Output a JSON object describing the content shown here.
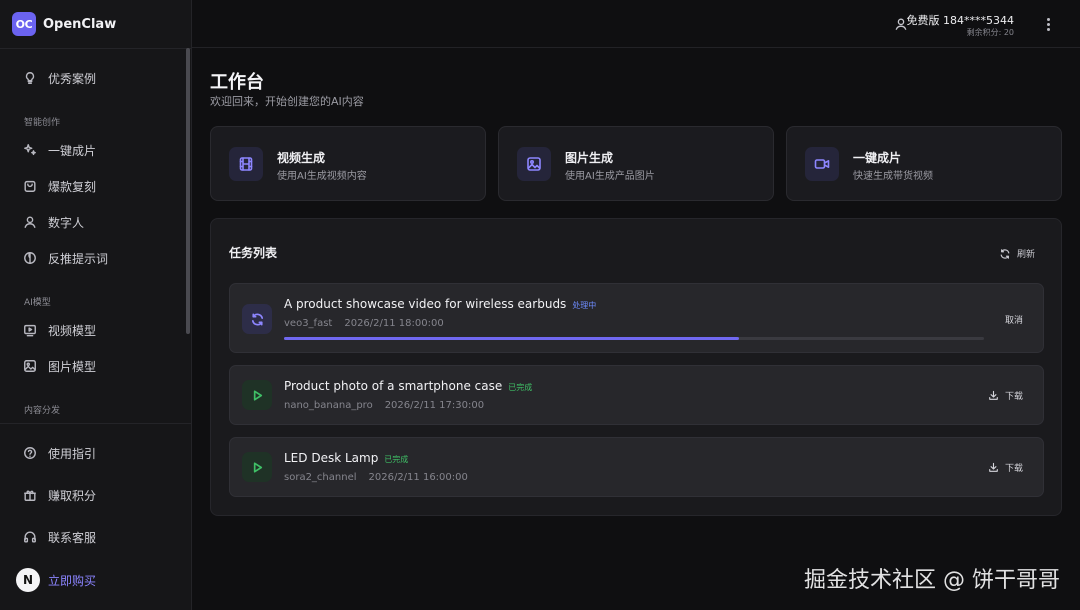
{
  "brand": {
    "logo_text": "OC",
    "name": "OpenClaw"
  },
  "sidebar": {
    "top_item": {
      "label": "优秀案例",
      "icon": "lightbulb-icon"
    },
    "sections": [
      {
        "title": "智能创作",
        "items": [
          {
            "label": "一键成片",
            "icon": "sparkles-icon"
          },
          {
            "label": "爆款复刻",
            "icon": "bag-icon"
          },
          {
            "label": "数字人",
            "icon": "user-icon"
          },
          {
            "label": "反推提示词",
            "icon": "compass-icon"
          }
        ]
      },
      {
        "title": "AI模型",
        "items": [
          {
            "label": "视频模型",
            "icon": "video-play-icon"
          },
          {
            "label": "图片模型",
            "icon": "image-icon"
          }
        ]
      },
      {
        "title": "内容分发",
        "items": []
      }
    ],
    "bottom_items": [
      {
        "label": "使用指引",
        "icon": "help-circle-icon"
      },
      {
        "label": "赚取积分",
        "icon": "gift-icon"
      },
      {
        "label": "联系客服",
        "icon": "headphones-icon"
      },
      {
        "label": "立即购买",
        "icon": "n-badge-icon",
        "badge": "N"
      }
    ]
  },
  "header": {
    "plan": "免费版",
    "phone": "184****5344",
    "points": "剩余积分: 20"
  },
  "main": {
    "title": "工作台",
    "subtitle": "欢迎回来，开始创建您的AI内容",
    "quick_actions": [
      {
        "title": "视频生成",
        "desc": "使用AI生成视频内容",
        "icon": "film-icon"
      },
      {
        "title": "图片生成",
        "desc": "使用AI生成产品图片",
        "icon": "image-icon"
      },
      {
        "title": "一键成片",
        "desc": "快速生成带货视频",
        "icon": "camera-icon"
      }
    ]
  },
  "tasks": {
    "title": "任务列表",
    "refresh_label": "刷新",
    "items": [
      {
        "name": "A product showcase video for wireless earbuds",
        "status": "处理中",
        "status_type": "processing",
        "model": "veo3_fast",
        "time": "2026/2/11 18:00:00",
        "progress": 0.65,
        "action": "取消"
      },
      {
        "name": "Product photo of a smartphone case",
        "status": "已完成",
        "status_type": "done",
        "model": "nano_banana_pro",
        "time": "2026/2/11 17:30:00",
        "action": "下载"
      },
      {
        "name": "LED Desk Lamp",
        "status": "已完成",
        "status_type": "done",
        "model": "sora2_channel",
        "time": "2026/2/11 16:00:00",
        "action": "下载"
      }
    ]
  },
  "watermark": "掘金技术社区 @ 饼干哥哥",
  "colors": {
    "accent": "#6b63f0",
    "processing": "#6e8cff",
    "done": "#3fbf66",
    "background": "#0f0f11"
  }
}
